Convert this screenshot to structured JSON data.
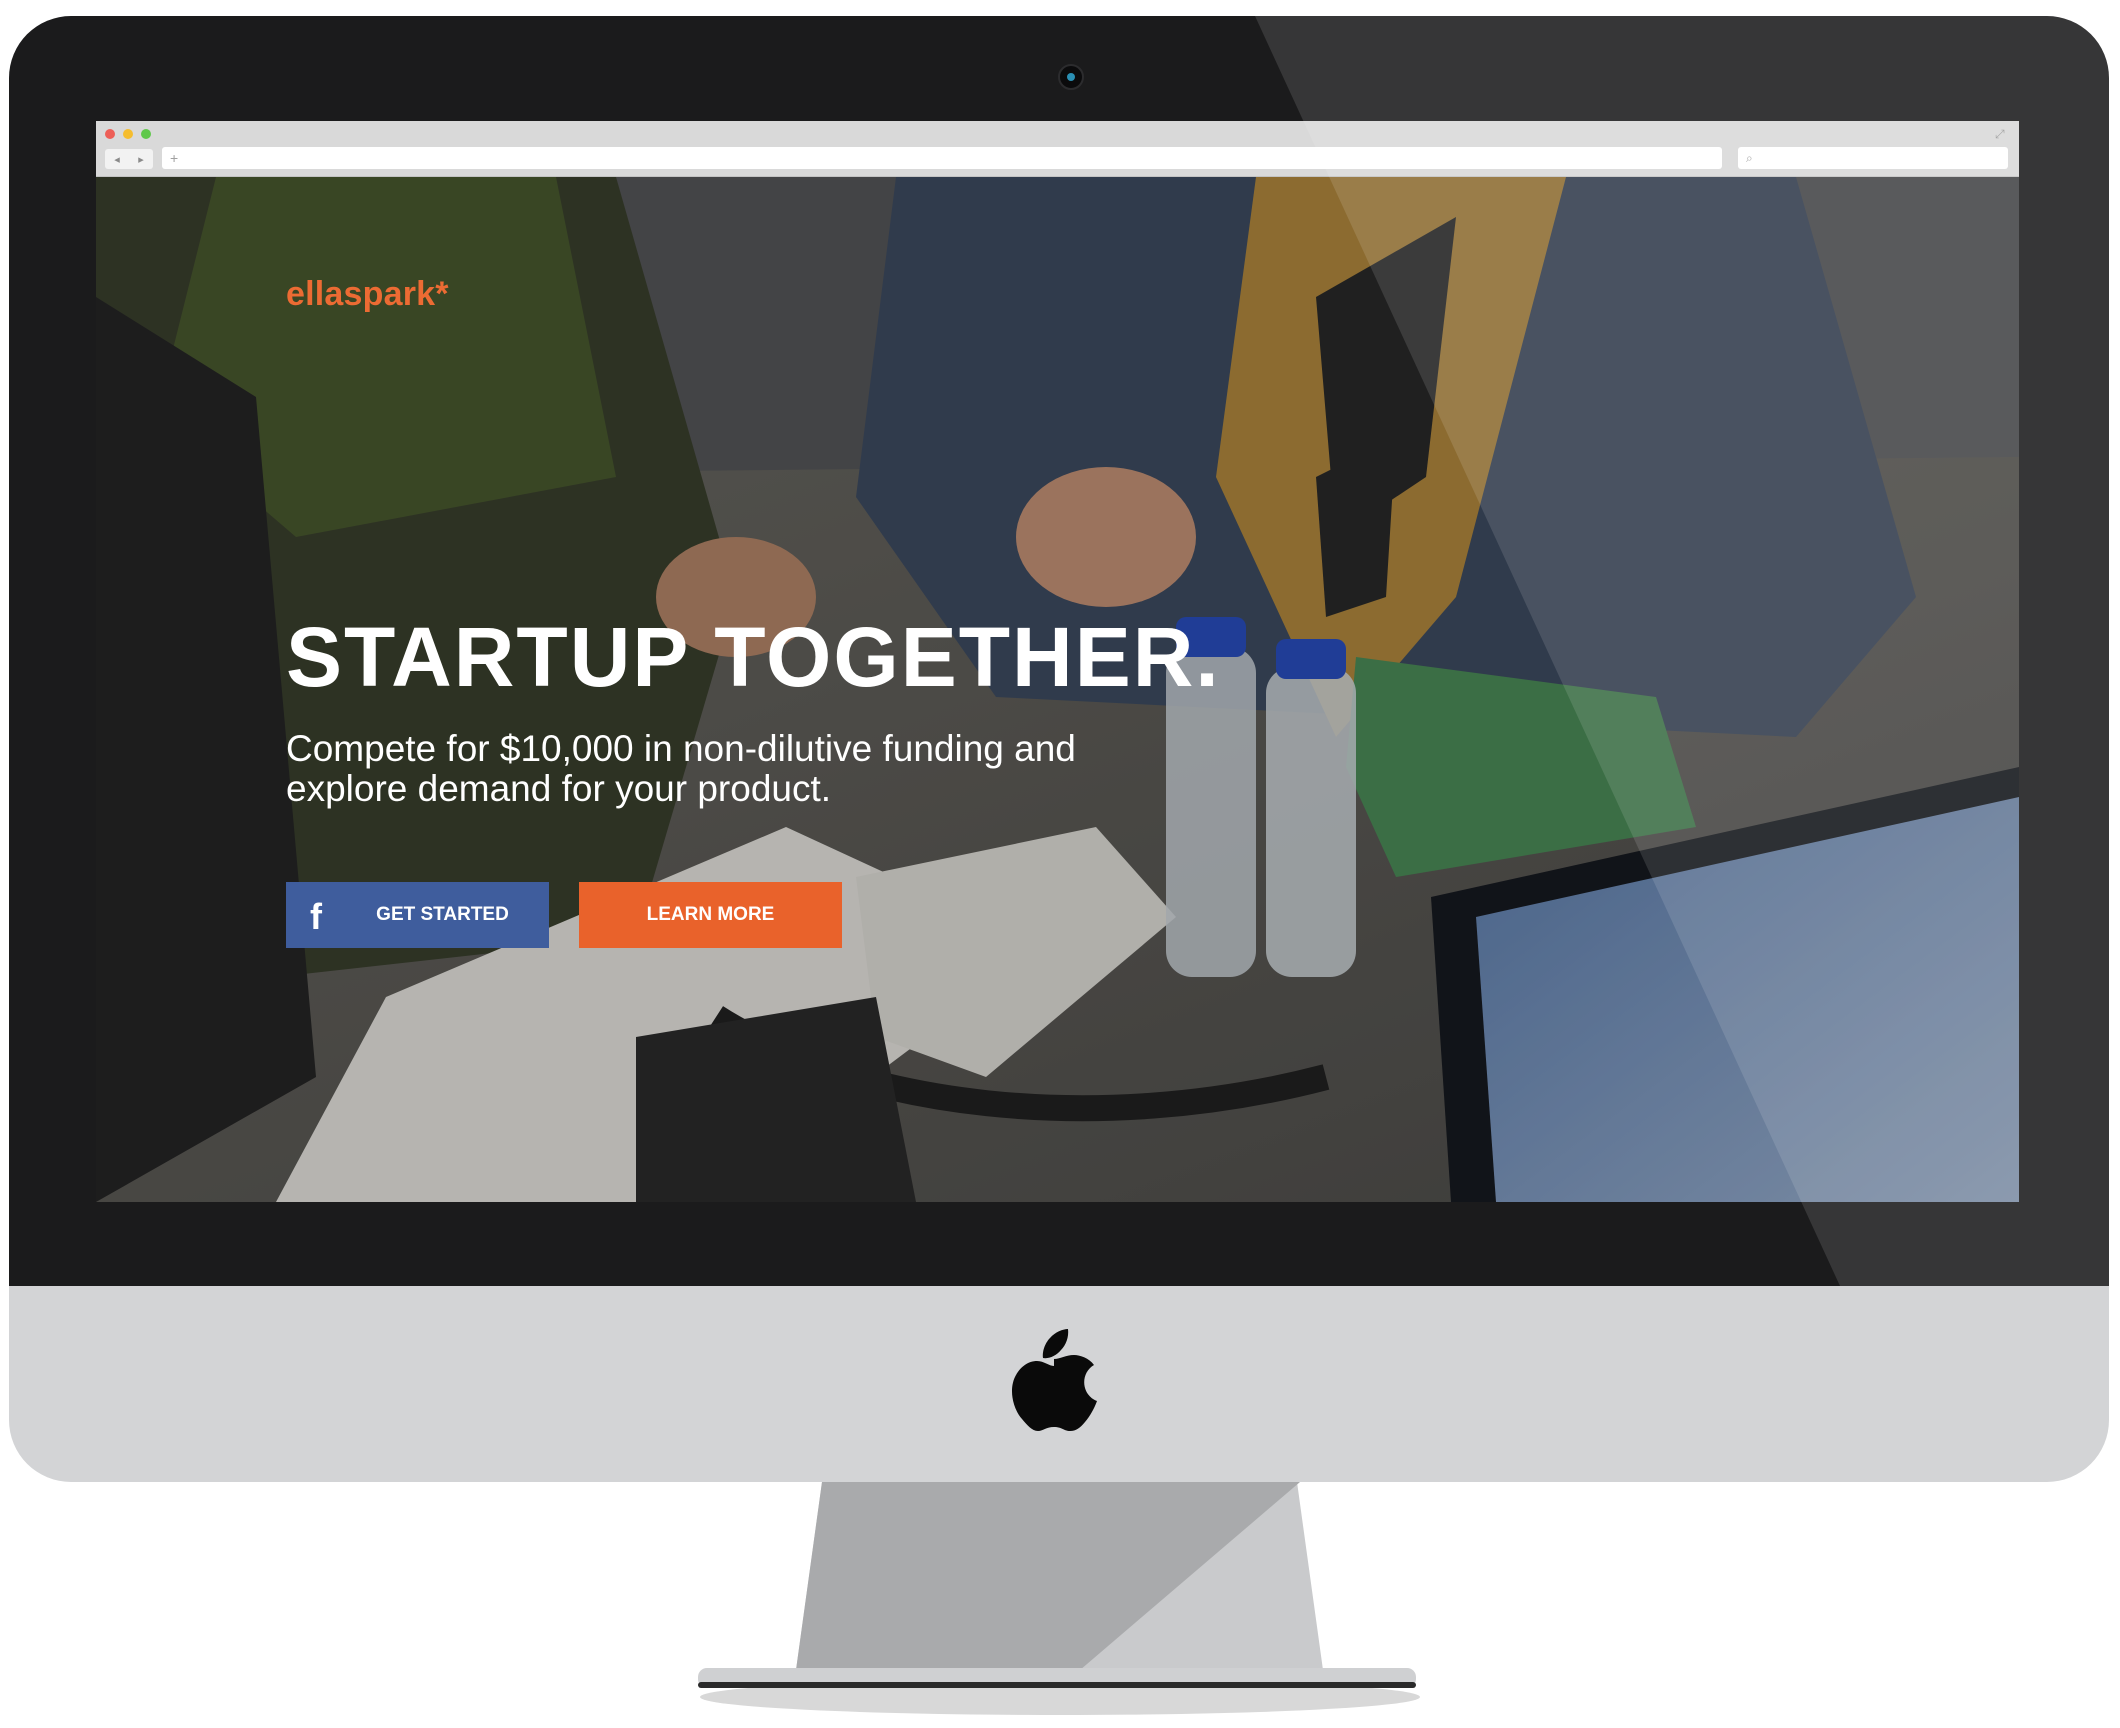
{
  "browser": {
    "traffic_lights": [
      "close",
      "minimize",
      "zoom"
    ],
    "nav_back": "◂",
    "nav_forward": "▸",
    "new_tab": "+",
    "search_icon": "⌕",
    "fullscreen": "⤢"
  },
  "site": {
    "logo": "ellaspark*",
    "headline": "STARTUP TOGETHER.",
    "subhead_line1": "Compete for $10,000 in non-dilutive funding and",
    "subhead_line2": "explore demand for your product.",
    "buttons": {
      "get_started": "GET STARTED",
      "learn_more": "LEARN MORE",
      "facebook_icon": "f"
    }
  },
  "colors": {
    "brand_orange": "#e9622b",
    "facebook_blue": "#3f5d9d",
    "bezel": "#1b1b1c",
    "chin": "#d3d4d6"
  }
}
